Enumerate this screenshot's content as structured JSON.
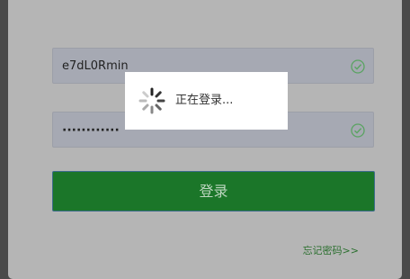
{
  "login": {
    "username_value": "e7dL0Rmin",
    "password_value": "············",
    "submit_label": "登录",
    "forgot_link": "忘记密码>>"
  },
  "loading": {
    "text": "正在登录..."
  },
  "icons": {
    "field_valid": "check-circle-icon",
    "loading": "spinner-icon"
  },
  "colors": {
    "accent": "#1b7629",
    "valid": "#5aa362",
    "link": "#2a6f2e"
  }
}
